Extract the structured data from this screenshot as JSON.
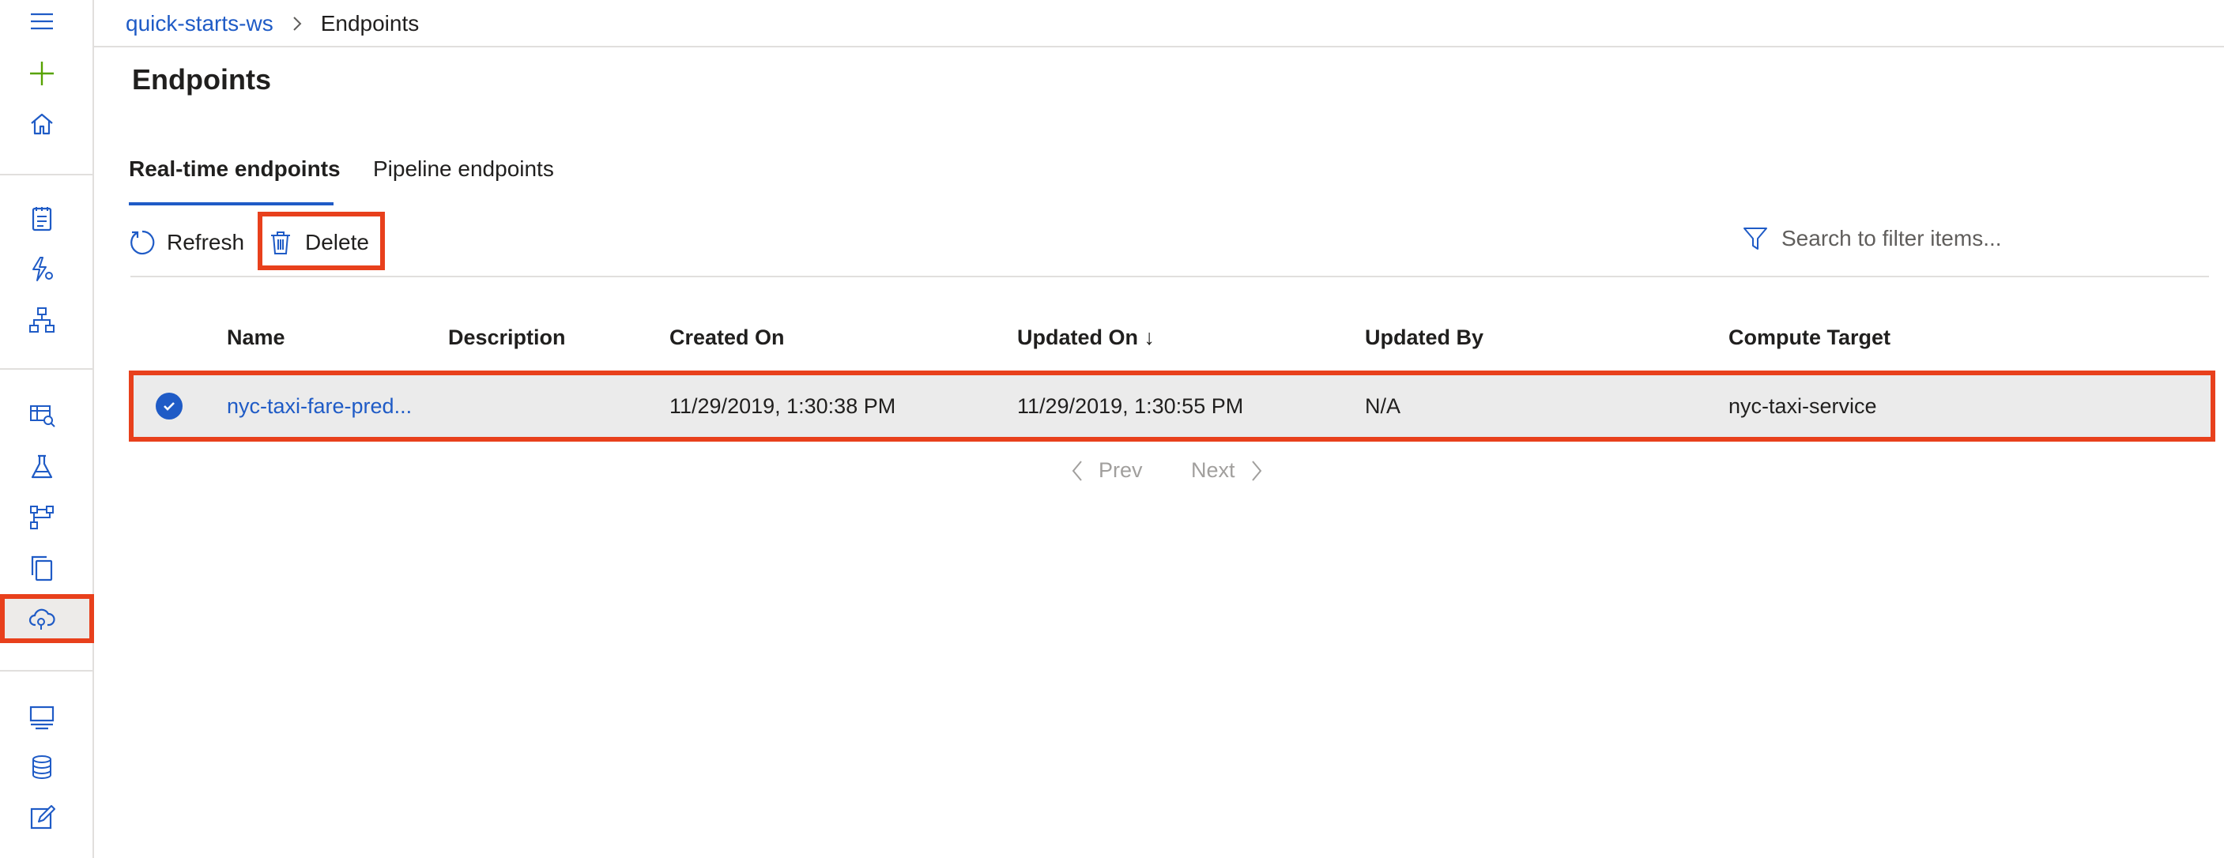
{
  "breadcrumb": {
    "workspace": "quick-starts-ws",
    "current": "Endpoints"
  },
  "page_title": "Endpoints",
  "tabs": [
    {
      "label": "Real-time endpoints",
      "active": true
    },
    {
      "label": "Pipeline endpoints",
      "active": false
    }
  ],
  "toolbar": {
    "refresh_label": "Refresh",
    "delete_label": "Delete"
  },
  "search": {
    "placeholder": "Search to filter items..."
  },
  "table": {
    "columns": [
      "Name",
      "Description",
      "Created On",
      "Updated On ↓",
      "Updated By",
      "Compute Target"
    ],
    "rows": [
      {
        "selected": true,
        "name": "nyc-taxi-fare-pred...",
        "description": "",
        "created_on": "11/29/2019, 1:30:38 PM",
        "updated_on": "11/29/2019, 1:30:55 PM",
        "updated_by": "N/A",
        "compute_target": "nyc-taxi-service"
      }
    ]
  },
  "pager": {
    "prev": "Prev",
    "next": "Next"
  },
  "sidebar": {
    "icons": [
      "menu-icon",
      "add-icon",
      "home-icon",
      "notebooks-icon",
      "automated-ml-icon",
      "designer-icon",
      "datasets-icon",
      "experiments-icon",
      "pipelines-icon",
      "models-icon",
      "endpoints-icon",
      "compute-icon",
      "datastores-icon",
      "data-labeling-icon"
    ],
    "selected": "endpoints-icon"
  },
  "colors": {
    "accent": "#1f5bc6",
    "highlight_box": "#e8401c",
    "add_icon": "#57a300",
    "selected_row": "#ebebeb"
  }
}
